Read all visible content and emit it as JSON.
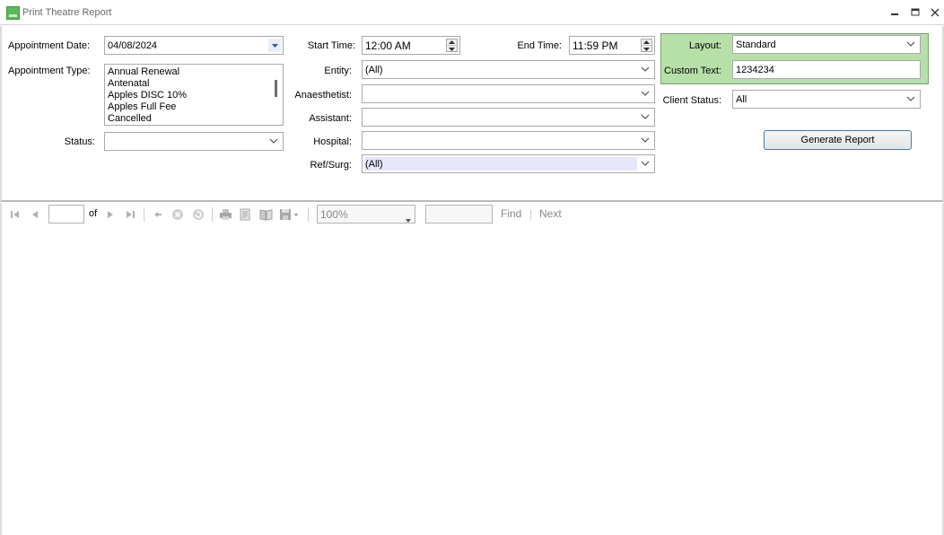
{
  "window": {
    "title": "Print Theatre Report",
    "controls": {
      "minimize": "minimize",
      "maximize": "maximize",
      "close": "close"
    }
  },
  "form": {
    "appointment_date": {
      "label": "Appointment Date:",
      "value": "04/08/2024"
    },
    "appointment_type": {
      "label": "Appointment Type:",
      "items": [
        "Annual Renewal",
        "Antenatal",
        "Apples DISC 10%",
        "Apples Full Fee",
        "Cancelled"
      ]
    },
    "status": {
      "label": "Status:",
      "value": ""
    },
    "start_time": {
      "label": "Start Time:",
      "value": "12:00 AM"
    },
    "end_time": {
      "label": "End Time:",
      "value": "11:59 PM"
    },
    "entity": {
      "label": "Entity:",
      "value": "(All)"
    },
    "anaesthetist": {
      "label": "Anaesthetist:",
      "value": ""
    },
    "assistant": {
      "label": "Assistant:",
      "value": ""
    },
    "hospital": {
      "label": "Hospital:",
      "value": ""
    },
    "ref_surg": {
      "label": "Ref/Surg:",
      "value": "(All)"
    },
    "layout": {
      "label": "Layout:",
      "value": "Standard"
    },
    "custom_text": {
      "label": "Custom Text:",
      "value": "1234234"
    },
    "client_status": {
      "label": "Client Status:",
      "value": "All"
    },
    "generate_button": "Generate Report"
  },
  "toolbar": {
    "of_label": "of",
    "zoom": "100%",
    "find_label": "Find",
    "separator": "|",
    "next_label": "Next"
  },
  "colors": {
    "panel_green": "#b7e0a8",
    "button_border": "#3c7fb1",
    "ref_surg_highlight": "#e6e6fa"
  }
}
